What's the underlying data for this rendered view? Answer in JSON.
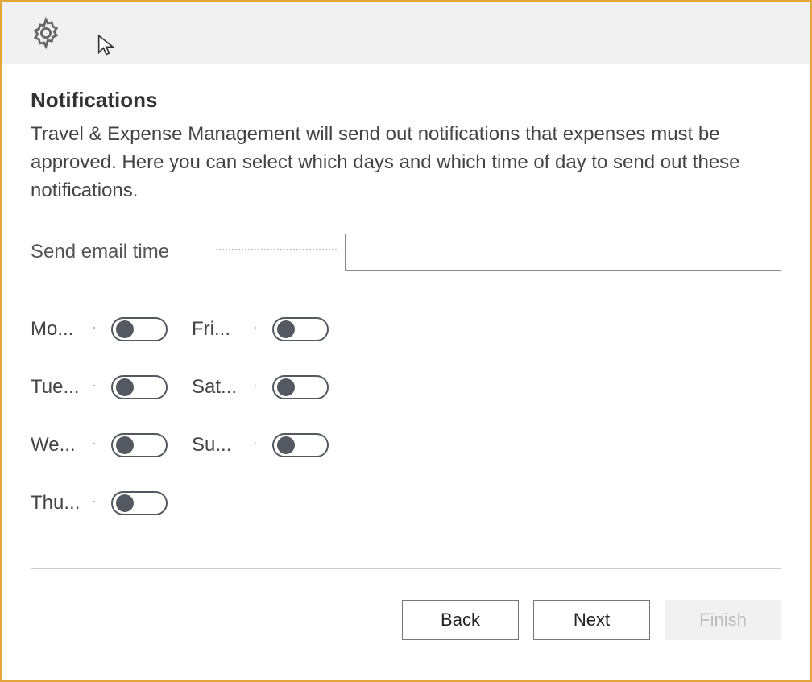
{
  "page": {
    "title": "Notifications",
    "description": "Travel & Expense Management will send out notifications that expenses must be approved. Here you can select which days and which time of day to send out these notifications."
  },
  "fields": {
    "send_email_time_label": "Send email time",
    "send_email_time_value": ""
  },
  "days": {
    "col1": [
      {
        "label": "Mo...",
        "name": "monday",
        "on": false
      },
      {
        "label": "Tue...",
        "name": "tuesday",
        "on": false
      },
      {
        "label": "We...",
        "name": "wednesday",
        "on": false
      },
      {
        "label": "Thu...",
        "name": "thursday",
        "on": false
      }
    ],
    "col2": [
      {
        "label": "Fri...",
        "name": "friday",
        "on": false
      },
      {
        "label": "Sat...",
        "name": "saturday",
        "on": false
      },
      {
        "label": "Su...",
        "name": "sunday",
        "on": false
      }
    ]
  },
  "footer": {
    "back": "Back",
    "next": "Next",
    "finish": "Finish"
  }
}
